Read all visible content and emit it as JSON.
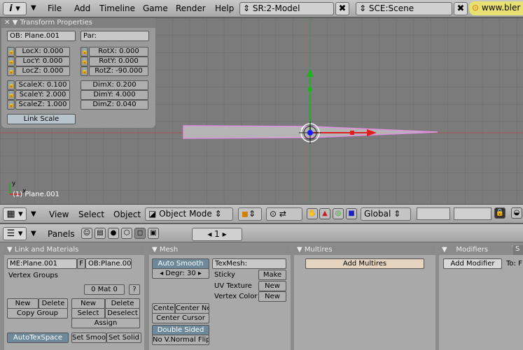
{
  "topbar": {
    "info_icon": "i",
    "menus": [
      "File",
      "Add",
      "Timeline",
      "Game",
      "Render",
      "Help"
    ],
    "screen_field": "SR:2-Model",
    "scene_field": "SCE:Scene",
    "close_glyph": "✖",
    "url_text": "www.bler"
  },
  "transform": {
    "title": "Transform Properties",
    "ob_field": "OB: Plane.001",
    "par_field": "Par:",
    "loc": [
      "LocX: 0.000",
      "LocY: 0.000",
      "LocZ: 0.000"
    ],
    "rot": [
      "RotX: 0.000",
      "RotY: 0.000",
      "RotZ: -90.000"
    ],
    "scale": [
      "ScaleX: 0.100",
      "ScaleY: 2.000",
      "ScaleZ: 1.000"
    ],
    "dim": [
      "DimX: 0.200",
      "DimY: 4.000",
      "DimZ: 0.040"
    ],
    "link_scale": "Link Scale"
  },
  "viewport": {
    "object_label": "(1) Plane.001",
    "axis_x": "x",
    "axis_y": "y"
  },
  "viewport_header": {
    "view": "View",
    "select": "Select",
    "object": "Object",
    "mode": "Object Mode",
    "orientation": "Global"
  },
  "buttons_header": {
    "panels": "Panels",
    "frame": "1"
  },
  "link_materials": {
    "title": "Link and Materials",
    "me_field": "ME:Plane.001",
    "f_label": "F",
    "ob_field": "OB:Plane.001",
    "vertex_groups": "Vertex Groups",
    "mat_field": "0 Mat 0",
    "question": "?",
    "vg_new": "New",
    "vg_delete": "Delete",
    "copy_group": "Copy Group",
    "mat_new": "New",
    "mat_delete": "Delete",
    "mat_select": "Select",
    "mat_deselect": "Deselect",
    "assign": "Assign",
    "autotexspace": "AutoTexSpace",
    "set_smooth": "Set Smoo",
    "set_solid": "Set Solid"
  },
  "mesh": {
    "title": "Mesh",
    "auto_smooth": "Auto Smooth",
    "degr": "Degr: 30",
    "texmesh": "TexMesh:",
    "sticky": "Sticky",
    "make": "Make",
    "uv_texture": "UV Texture",
    "uv_new": "New",
    "vertex_color": "Vertex Color",
    "vc_new": "New",
    "center": "Cente",
    "center_new": "Center Ne",
    "center_cursor": "Center Cursor",
    "double_sided": "Double Sided",
    "no_vnormal_flip": "No V.Normal Flip"
  },
  "multires": {
    "title": "Multires",
    "add_multires": "Add Multires"
  },
  "modifiers": {
    "title": "Modifiers",
    "tab2": "S",
    "add_modifier": "Add Modifier",
    "to": "To: F"
  },
  "colors": {
    "object_pink": "#e08fe0",
    "axis_red": "#e02020",
    "axis_green": "#20b020",
    "center_blue": "#1a1aff"
  }
}
